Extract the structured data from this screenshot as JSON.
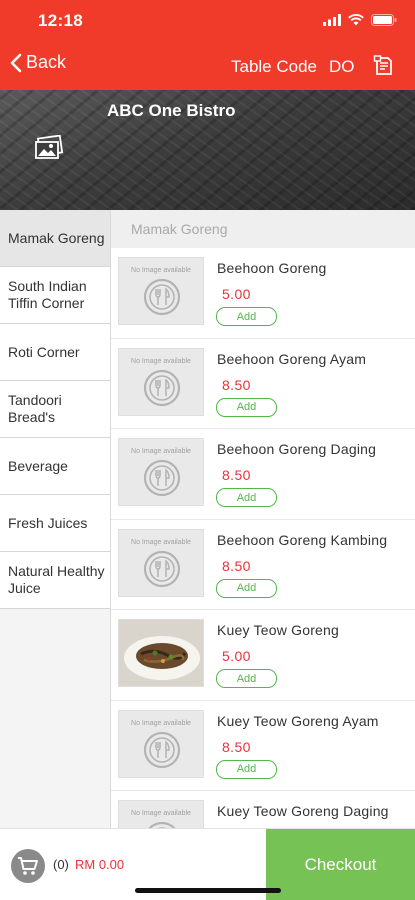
{
  "status_bar": {
    "time": "12:18"
  },
  "nav": {
    "back_label": "Back",
    "table_code_label": "Table Code",
    "table_code_value": "DO",
    "receipt_icon": "receipt-icon"
  },
  "restaurant": {
    "name": "ABC One Bistro",
    "photo_icon": "photo-icon"
  },
  "categories": [
    {
      "label": "Mamak Goreng",
      "active": true
    },
    {
      "label": "South Indian Tiffin Corner",
      "active": false
    },
    {
      "label": "Roti Corner",
      "active": false
    },
    {
      "label": "Tandoori Bread's",
      "active": false
    },
    {
      "label": "Beverage",
      "active": false
    },
    {
      "label": "Fresh Juices",
      "active": false
    },
    {
      "label": "Natural Healthy Juice",
      "active": false
    }
  ],
  "menu": {
    "section_title": "Mamak Goreng",
    "no_image_text": "No Image available",
    "add_label": "Add",
    "items": [
      {
        "name": "Beehoon Goreng",
        "price": "5.00",
        "has_image": false
      },
      {
        "name": "Beehoon Goreng Ayam",
        "price": "8.50",
        "has_image": false
      },
      {
        "name": "Beehoon Goreng Daging",
        "price": "8.50",
        "has_image": false
      },
      {
        "name": "Beehoon Goreng Kambing",
        "price": "8.50",
        "has_image": false
      },
      {
        "name": "Kuey Teow Goreng",
        "price": "5.00",
        "has_image": true
      },
      {
        "name": "Kuey Teow Goreng Ayam",
        "price": "8.50",
        "has_image": false
      },
      {
        "name": "Kuey Teow Goreng Daging",
        "price": "8.50",
        "has_image": false
      }
    ]
  },
  "cart": {
    "count": "(0)",
    "total": "RM 0.00",
    "checkout_label": "Checkout"
  },
  "colors": {
    "brand_red": "#f03a2a",
    "price_red": "#e8323a",
    "add_green": "#52b84a",
    "checkout_green": "#76c254"
  }
}
